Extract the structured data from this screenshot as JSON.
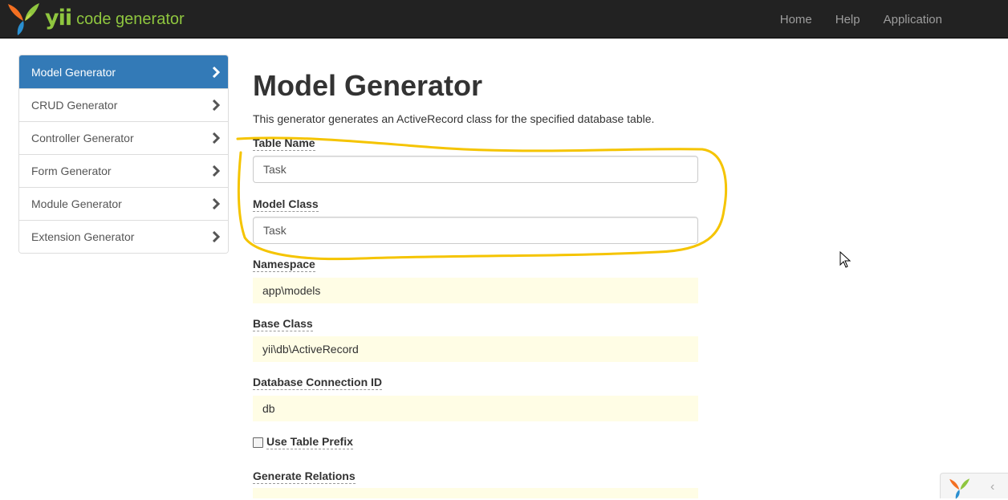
{
  "brand": {
    "logo_icon": "yii-logo-icon",
    "name": "yii",
    "subtitle": "code generator"
  },
  "navbar": {
    "links": [
      "Home",
      "Help",
      "Application"
    ]
  },
  "sidebar": {
    "items": [
      {
        "label": "Model Generator",
        "active": true
      },
      {
        "label": "CRUD Generator",
        "active": false
      },
      {
        "label": "Controller Generator",
        "active": false
      },
      {
        "label": "Form Generator",
        "active": false
      },
      {
        "label": "Module Generator",
        "active": false
      },
      {
        "label": "Extension Generator",
        "active": false
      }
    ],
    "chevron_icon": "chevron-right-icon"
  },
  "main": {
    "title": "Model Generator",
    "description": "This generator generates an ActiveRecord class for the specified database table.",
    "fields": {
      "table_name": {
        "label": "Table Name",
        "value": "Task"
      },
      "model_class": {
        "label": "Model Class",
        "value": "Task"
      },
      "namespace": {
        "label": "Namespace",
        "value": "app\\models"
      },
      "base_class": {
        "label": "Base Class",
        "value": "yii\\db\\ActiveRecord"
      },
      "db_connection": {
        "label": "Database Connection ID",
        "value": "db"
      },
      "use_table_prefix": {
        "label": "Use Table Prefix",
        "checked": false
      },
      "generate_relations": {
        "label": "Generate Relations"
      }
    }
  },
  "annotation": {
    "color": "#f5c400",
    "shape": "hand-drawn-ellipse"
  },
  "colors": {
    "navbar_bg": "#222222",
    "active_item": "#337ab7",
    "sticky_field_bg": "#fffde5",
    "brand_green": "#8fc63f"
  },
  "debug_toolbar": {
    "logo_icon": "yii-logo-icon",
    "toggle_icon": "chevron-left-icon"
  }
}
